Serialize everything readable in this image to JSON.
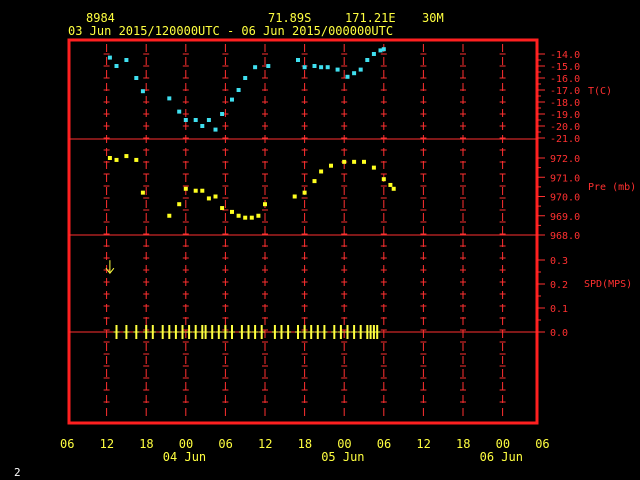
{
  "header": {
    "station": "8984",
    "lat": "71.89S",
    "lon": "171.21E",
    "elev": "30M",
    "range": "03 Jun 2015/120000UTC - 06 Jun 2015/000000UTC"
  },
  "page_number": "2",
  "colors": {
    "frame": "#ff2020",
    "grid": "#ff3030",
    "temp": "#40e0f0",
    "pres": "#ffff20",
    "wind": "#ffff40",
    "text": "#ffff40"
  },
  "chart_data": [
    {
      "type": "scatter",
      "panel": "temperature",
      "ylabel": "T(C)",
      "ylim": [
        -21.0,
        -13.5
      ],
      "yticks": [
        "-14.0",
        "-15.0",
        "-16.0",
        "-17.0",
        "-18.0",
        "-19.0",
        "-20.0",
        "-21.0"
      ],
      "ytick_values": [
        -14,
        -15,
        -16,
        -17,
        -18,
        -19,
        -20,
        -21
      ],
      "x_hours": [
        12.5,
        13.5,
        15.0,
        16.5,
        17.5,
        21.5,
        23.0,
        24.0,
        25.5,
        26.5,
        27.5,
        28.5,
        29.5,
        31.0,
        32.0,
        33.0,
        34.5,
        36.5,
        41.0,
        42.0,
        43.5,
        44.5,
        45.5,
        47.0,
        48.5,
        49.5,
        50.5,
        51.5,
        52.5,
        53.5,
        54.0
      ],
      "values": [
        -14.3,
        -15.0,
        -14.5,
        -16.0,
        -17.1,
        -17.7,
        -18.8,
        -19.5,
        -19.5,
        -20.0,
        -19.5,
        -20.3,
        -19.0,
        -17.8,
        -17.0,
        -16.0,
        -15.1,
        -15.0,
        -14.5,
        -15.1,
        -15.0,
        -15.1,
        -15.1,
        -15.3,
        -15.9,
        -15.6,
        -15.3,
        -14.5,
        -14.0,
        -13.7,
        -13.6
      ]
    },
    {
      "type": "scatter",
      "panel": "pressure",
      "ylabel": "Pre (mb)",
      "ylim": [
        967.8,
        972.7
      ],
      "yticks": [
        "972.0",
        "971.0",
        "970.0",
        "969.0",
        "968.0"
      ],
      "ytick_values": [
        972,
        971,
        970,
        969,
        968
      ],
      "x_hours": [
        12.5,
        13.5,
        15.0,
        16.5,
        17.5,
        21.5,
        23.0,
        24.0,
        25.5,
        26.5,
        27.5,
        28.5,
        29.5,
        31.0,
        32.0,
        33.0,
        34.0,
        35.0,
        36.0,
        40.5,
        42.0,
        43.5,
        44.5,
        46.0,
        48.0,
        49.5,
        51.0,
        52.5,
        54.0,
        55.0,
        55.5
      ],
      "values": [
        972.0,
        971.9,
        972.1,
        971.9,
        970.2,
        969.0,
        969.6,
        970.4,
        970.3,
        970.3,
        969.9,
        970.0,
        969.4,
        969.2,
        969.0,
        968.9,
        968.9,
        969.0,
        969.6,
        970.0,
        970.2,
        970.8,
        971.3,
        971.6,
        971.8,
        971.8,
        971.8,
        971.5,
        970.9,
        970.6,
        970.4
      ]
    },
    {
      "type": "scatter",
      "panel": "wind",
      "ylabel": "SPD(MPS)",
      "ylim": [
        0,
        0.3
      ],
      "yticks": [
        "0.3",
        "0.2",
        "0.1",
        "0.0"
      ],
      "ytick_values": [
        0.3,
        0.2,
        0.1,
        0.0
      ],
      "arrow": {
        "x_hour": 12.5,
        "value": 0.27
      },
      "calm_x_hours": [
        13.5,
        15.0,
        16.5,
        18.0,
        19.0,
        20.5,
        21.5,
        22.5,
        23.5,
        24.5,
        25.5,
        26.5,
        27.0,
        28.0,
        29.0,
        30.0,
        31.0,
        32.5,
        33.5,
        34.5,
        35.5,
        37.5,
        38.5,
        39.5,
        41.0,
        42.0,
        43.0,
        44.0,
        45.0,
        46.5,
        47.5,
        48.5,
        49.5,
        50.5,
        51.5,
        52.0,
        52.5,
        53.0
      ]
    }
  ],
  "x_axis": {
    "labels": [
      "06",
      "12",
      "18",
      "00",
      "06",
      "12",
      "18",
      "00",
      "06",
      "12",
      "18",
      "00",
      "06"
    ],
    "label_hours": [
      6,
      12,
      18,
      24,
      30,
      36,
      42,
      48,
      54,
      60,
      66,
      72,
      78
    ],
    "dates": [
      {
        "text": "04 Jun",
        "hour": 24
      },
      {
        "text": "05 Jun",
        "hour": 48
      },
      {
        "text": "06 Jun",
        "hour": 72
      }
    ]
  }
}
